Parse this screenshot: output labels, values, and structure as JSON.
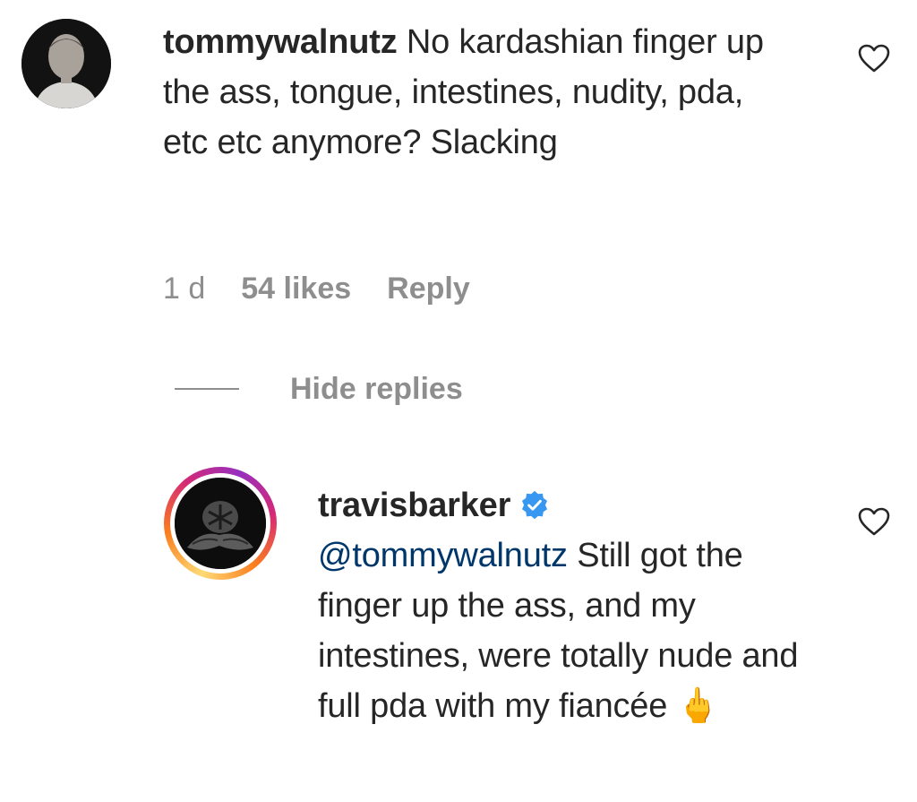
{
  "comments": [
    {
      "username": "tommywalnutz",
      "text": "No kardashian finger up the ass, tongue, intestines, nudity, pda, etc etc anymore? Slacking",
      "time": "1 d",
      "likes": "54 likes",
      "reply_label": "Reply"
    }
  ],
  "thread": {
    "hide_replies_label": "Hide replies"
  },
  "replies": [
    {
      "username": "travisbarker",
      "verified": true,
      "mention": "@tommywalnutz",
      "text": "Still got the finger up the ass, and my intestines, were totally nude and full pda with my fiancée",
      "emoji": "🖕"
    }
  ],
  "colors": {
    "text": "#262626",
    "muted": "#8e8e8e",
    "mention": "#00376b",
    "verified": "#3897f0"
  },
  "icons": [
    "heart-outline-icon",
    "verified-badge-icon"
  ]
}
